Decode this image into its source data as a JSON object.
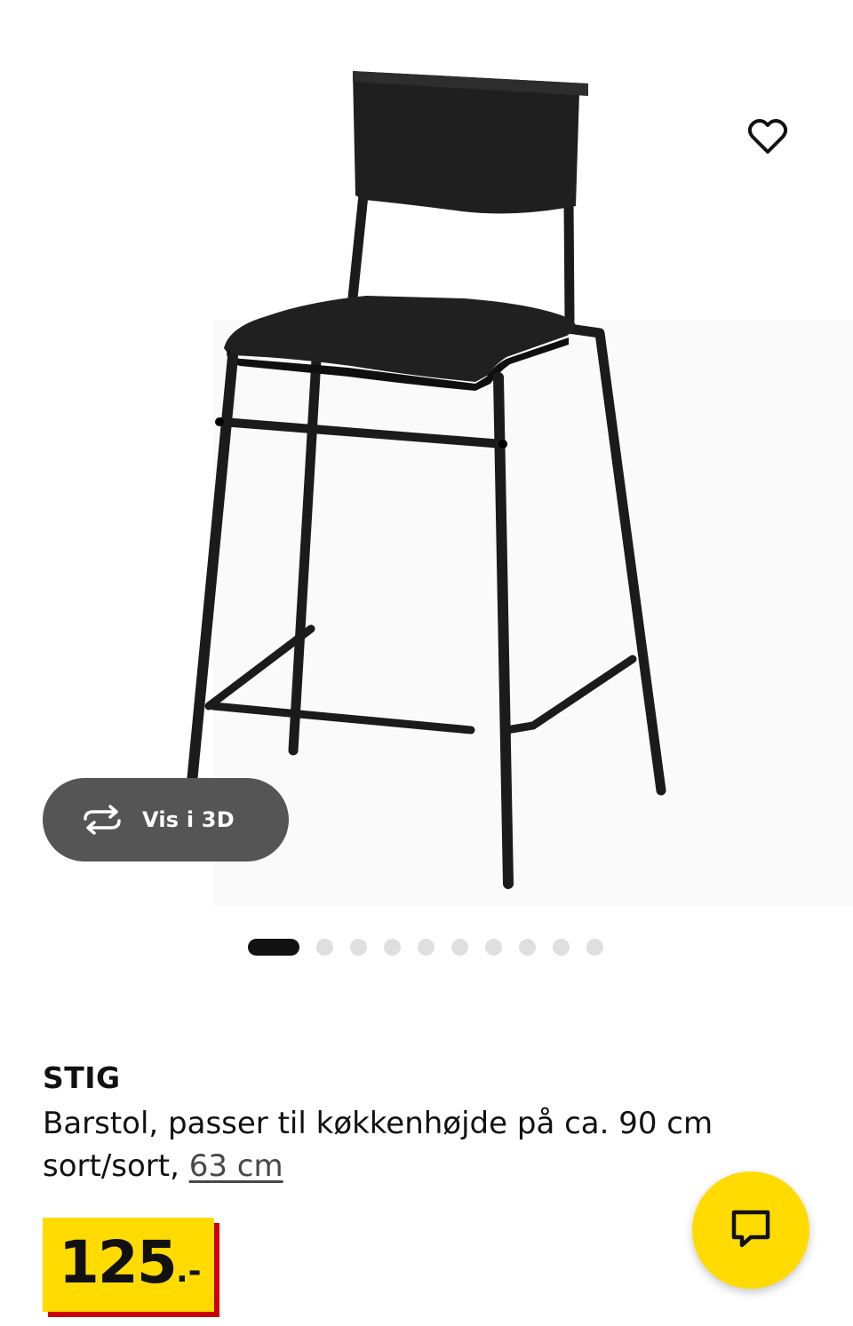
{
  "gallery": {
    "image_alt": "STIG barstol sort",
    "view3d_label": "Vis i 3D",
    "favorite_icon": "heart-icon",
    "view3d_icon": "rotate-3d-icon",
    "slide_count": 10,
    "active_slide": 1
  },
  "product": {
    "name": "STIG",
    "description": "Barstol, passer til køkkenhøjde på ca. 90 cm",
    "variant": "sort/sort,",
    "size": "63 cm"
  },
  "price": {
    "amount": "125",
    "suffix": ".-",
    "tag_color": "#ffdb00",
    "tag_shadow_color": "#cc0008"
  },
  "chat": {
    "icon": "chat-icon",
    "button_color": "#ffdb00"
  }
}
